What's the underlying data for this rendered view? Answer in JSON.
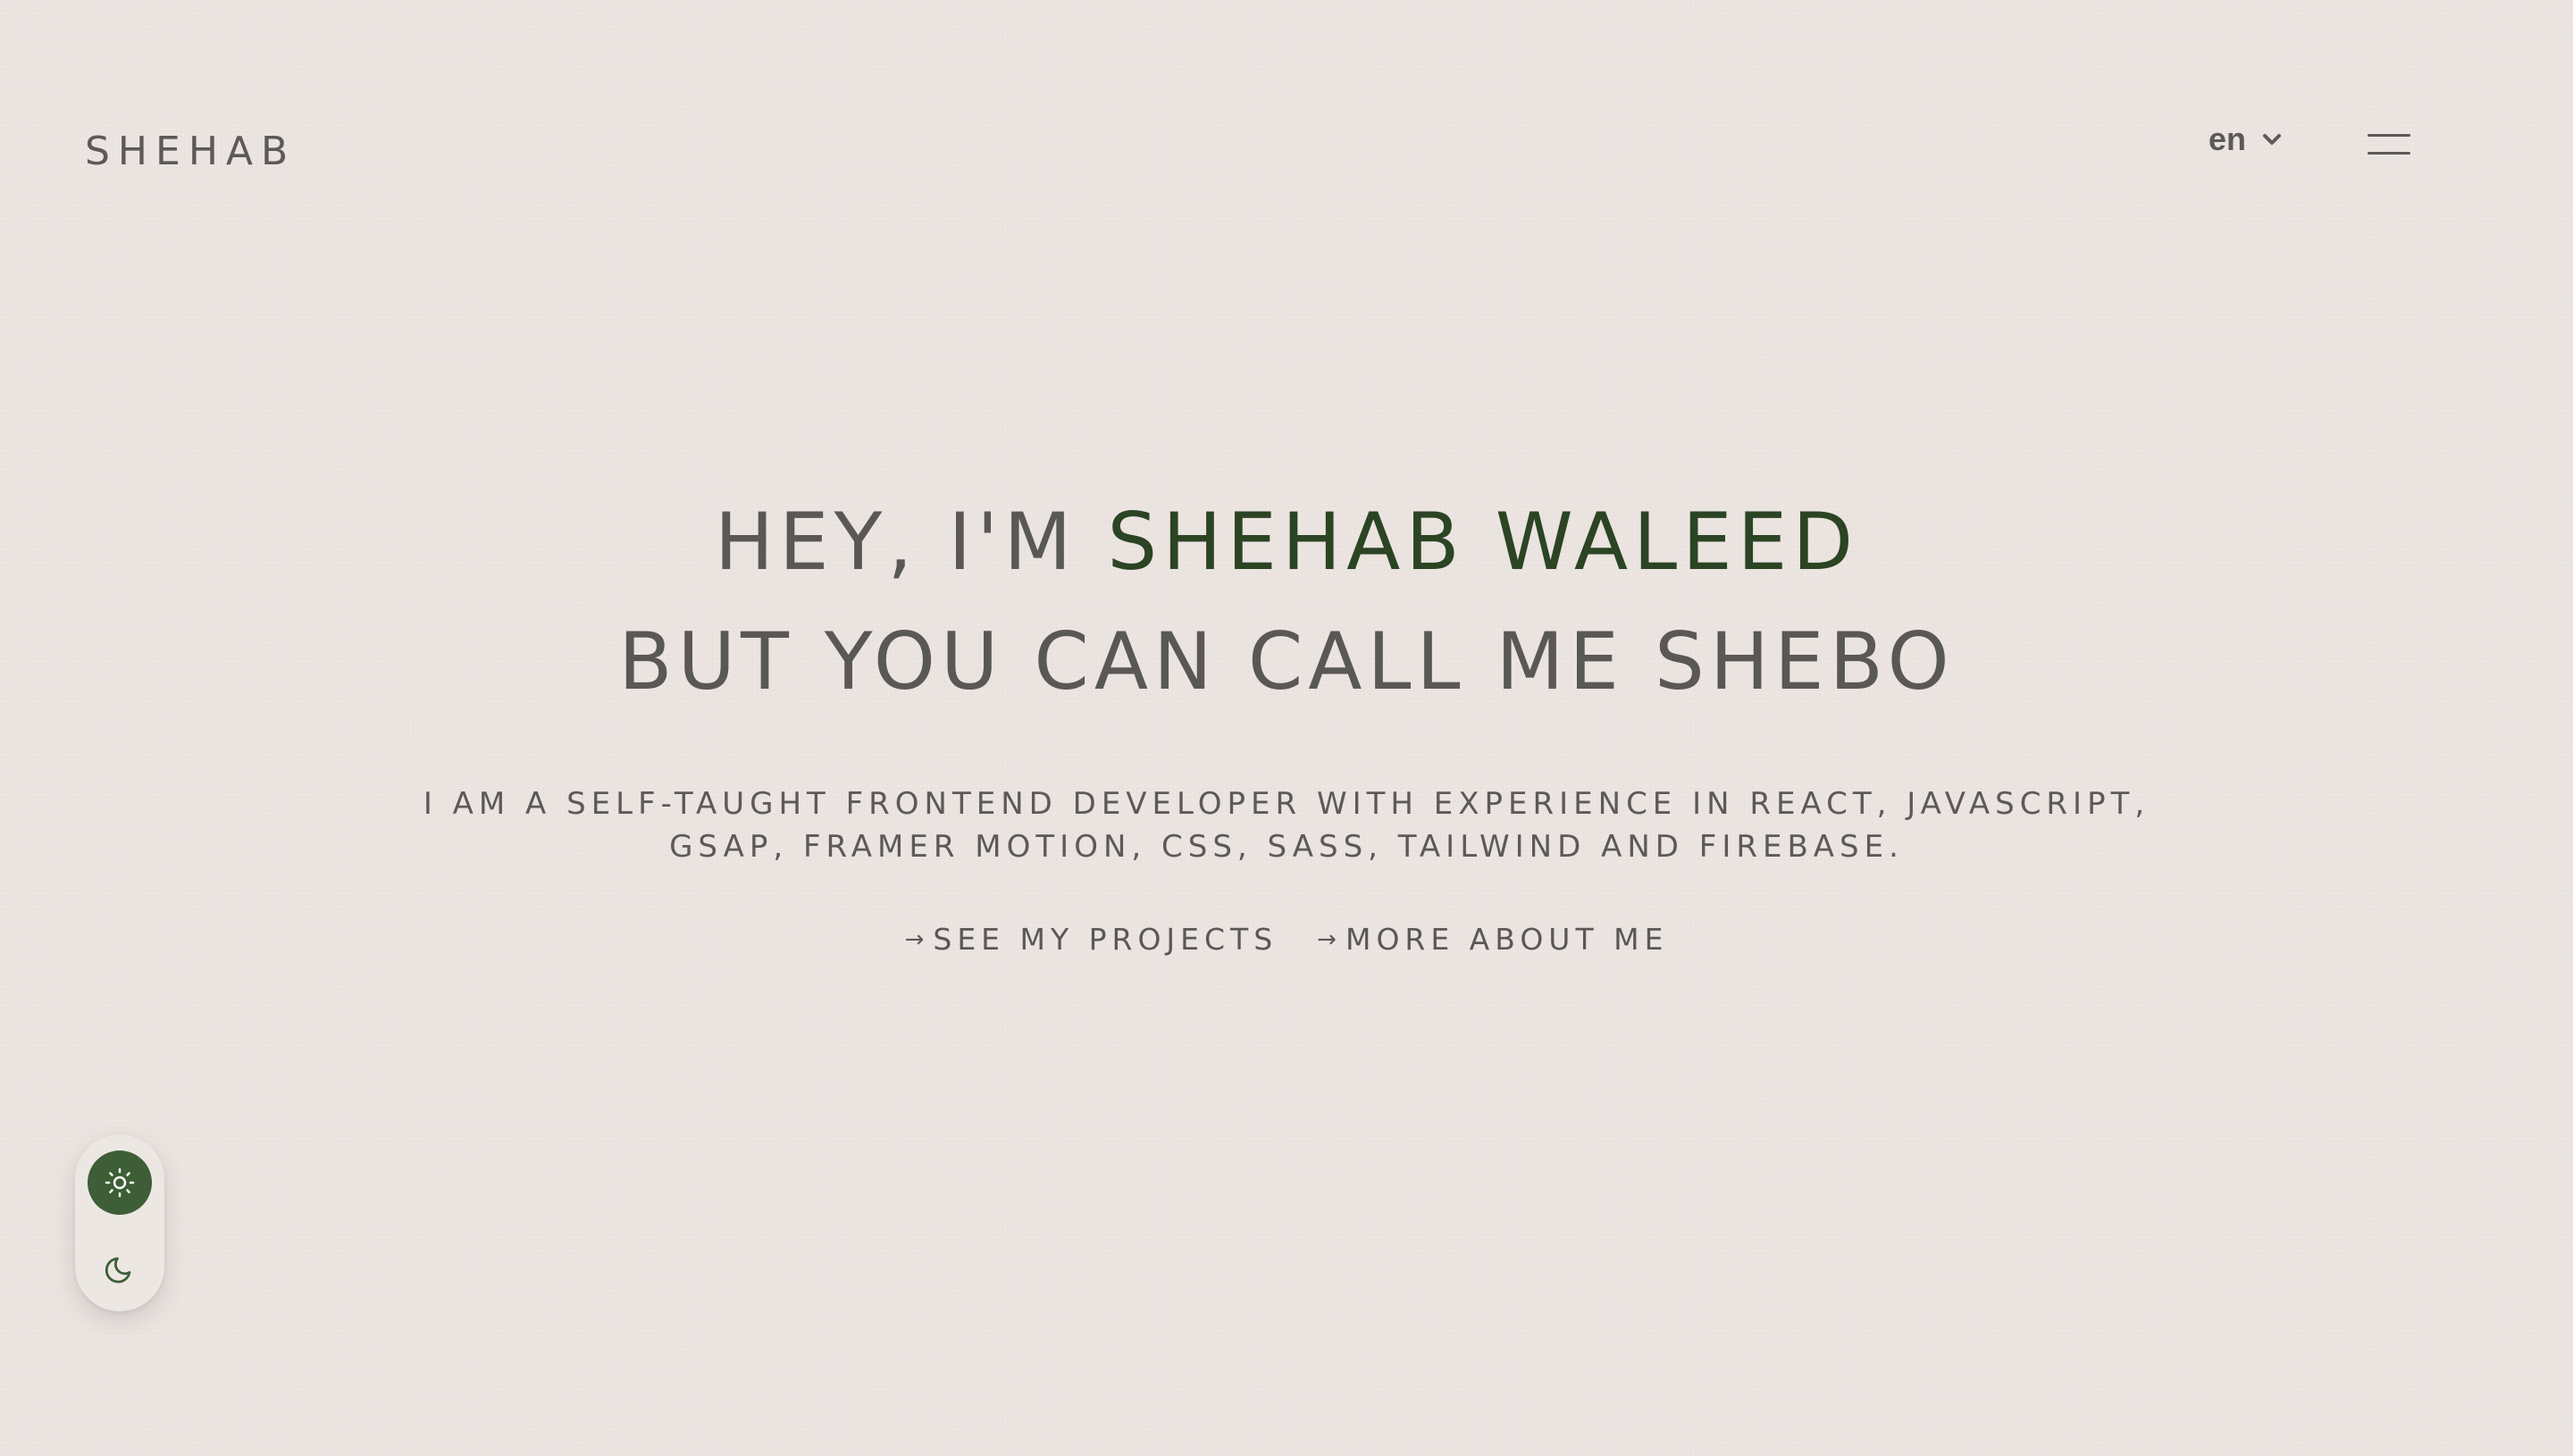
{
  "header": {
    "logo": "SHEHAB",
    "language": {
      "selected": "en",
      "icon": "chevron-down-icon"
    },
    "menu_icon": "hamburger-menu-icon"
  },
  "hero": {
    "headline": {
      "line1_prefix": "HEY, I'M ",
      "line1_name": "SHEHAB WALEED",
      "line2": "BUT YOU CAN CALL ME SHEBO"
    },
    "subtitle": {
      "line1": "I AM A SELF-TAUGHT FRONTEND DEVELOPER WITH EXPERIENCE IN REACT, JAVASCRIPT,",
      "line2": "GSAP, FRAMER MOTION, CSS, SASS, TAILWIND AND FIREBASE."
    },
    "cta_arrow": "→",
    "ctas": {
      "projects": "SEE MY PROJECTS",
      "about": "MORE ABOUT ME"
    }
  },
  "theme_toggle": {
    "active": "light",
    "light_icon": "sun-icon",
    "dark_icon": "moon-icon"
  },
  "colors": {
    "background": "#ebe4e0",
    "text": "#5a5856",
    "accent": "#2b4424",
    "toggle_active": "#3d5e36"
  }
}
